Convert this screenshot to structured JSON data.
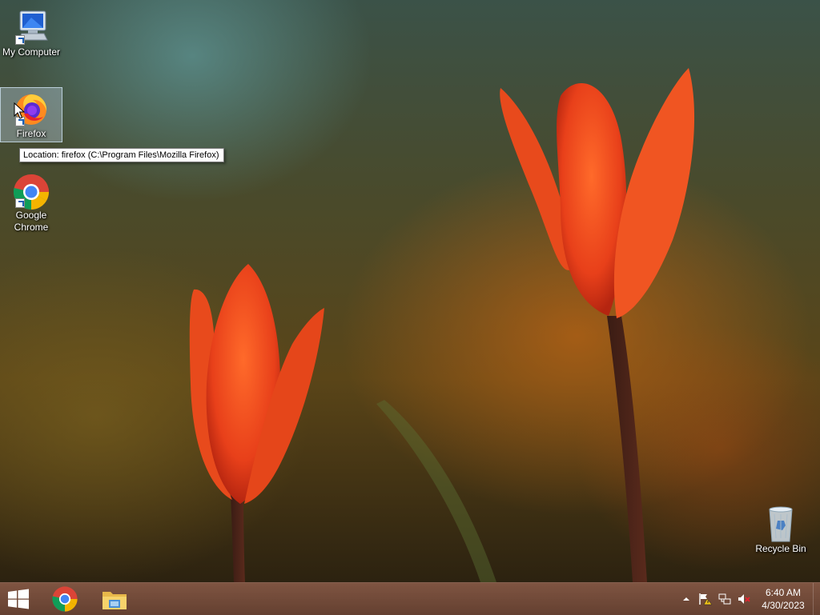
{
  "desktop": {
    "icons": [
      {
        "label": "My Computer",
        "icon": "computer-icon"
      },
      {
        "label": "Firefox",
        "icon": "firefox-icon"
      },
      {
        "label": "Google Chrome",
        "icon": "chrome-icon"
      },
      {
        "label": "Recycle Bin",
        "icon": "recycle-bin-icon"
      }
    ],
    "tooltip": "Location: firefox (C:\\Program Files\\Mozilla Firefox)"
  },
  "taskbar": {
    "start_icon": "windows-logo-icon",
    "pinned": [
      {
        "name": "Google Chrome",
        "icon": "chrome-icon"
      },
      {
        "name": "File Explorer",
        "icon": "folder-icon"
      }
    ],
    "tray": {
      "icons": [
        "chevron-up-icon",
        "action-center-flag-icon",
        "network-icon",
        "volume-muted-icon"
      ],
      "time": "6:40 AM",
      "date": "4/30/2023"
    }
  },
  "colors": {
    "taskbar": "#6e4634",
    "tulip": "#f0501e"
  }
}
